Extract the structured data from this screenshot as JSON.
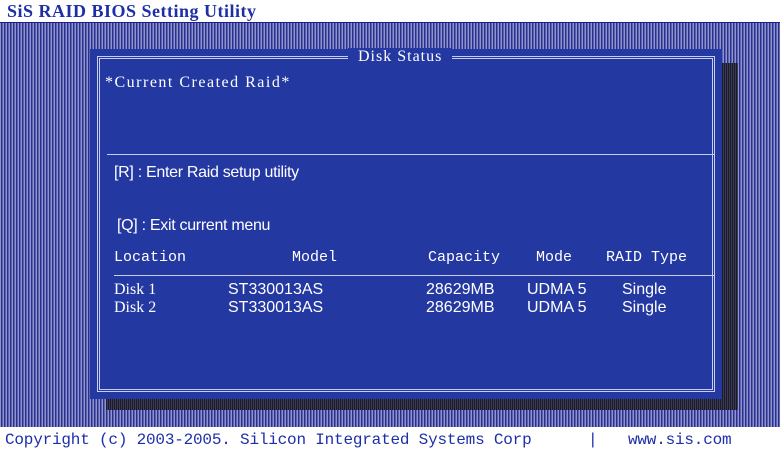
{
  "window": {
    "title": "SiS RAID BIOS Setting Utility"
  },
  "panel": {
    "title": "Disk Status",
    "current_raid_label": "*Current Created Raid*",
    "menu": {
      "enter_raid": "[R] : Enter Raid setup utility",
      "exit_menu": "[Q] : Exit current menu"
    },
    "table": {
      "headers": [
        "Location",
        "Model",
        "Capacity",
        "Mode",
        "RAID Type"
      ],
      "rows": [
        {
          "location": "Disk 1",
          "model": "ST330013AS",
          "capacity": "28629MB",
          "mode": "UDMA 5",
          "raid_type": "Single"
        },
        {
          "location": "Disk 2",
          "model": "ST330013AS",
          "capacity": "28629MB",
          "mode": "UDMA 5",
          "raid_type": "Single"
        }
      ]
    }
  },
  "footer": {
    "copyright": "Copyright (c) 2003-2005. Silicon Integrated Systems Corp",
    "separator": "|",
    "website": "www.sis.com"
  },
  "colors": {
    "panel_background": "#2438a2",
    "title_text": "#1d2fa8",
    "body_text": "#ffffff"
  }
}
